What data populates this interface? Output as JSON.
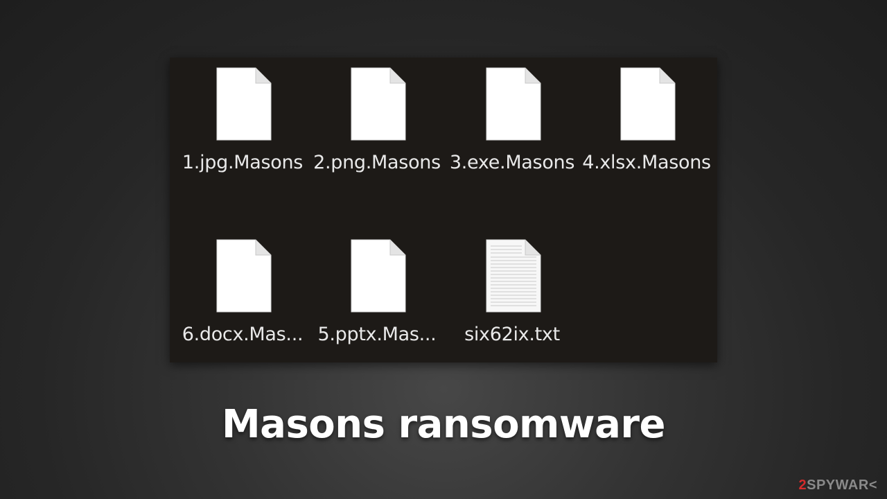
{
  "title": "Masons ransomware",
  "watermark": {
    "digit": "2",
    "word": "SPYWAR",
    "arrow": "<"
  },
  "files": [
    {
      "name": "1.jpg.Masons",
      "icon": "blank-file-icon"
    },
    {
      "name": "2.png.Masons",
      "icon": "blank-file-icon"
    },
    {
      "name": "3.exe.Masons",
      "icon": "blank-file-icon"
    },
    {
      "name": "4.xlsx.Masons",
      "icon": "blank-file-icon"
    },
    {
      "name": "6.docx.Mas...",
      "icon": "blank-file-icon"
    },
    {
      "name": "5.pptx.Mas...",
      "icon": "blank-file-icon"
    },
    {
      "name": "six62ix.txt",
      "icon": "text-file-icon"
    }
  ],
  "colors": {
    "panel": "#1d1a17",
    "file_label": "#e9e9e9",
    "watermark_accent": "#d42b2b"
  }
}
